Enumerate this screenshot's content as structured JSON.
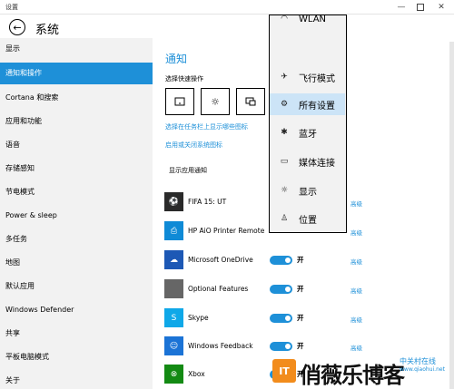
{
  "window": {
    "title": "设置"
  },
  "header": {
    "back_icon": "back-arrow-icon",
    "title": "系统"
  },
  "sidebar": {
    "items": [
      {
        "label": "显示",
        "active": false
      },
      {
        "label": "通知和操作",
        "active": true
      },
      {
        "label": "Cortana 和搜索",
        "active": false
      },
      {
        "label": "应用和功能",
        "active": false
      },
      {
        "label": "语音",
        "active": false
      },
      {
        "label": "存储感知",
        "active": false
      },
      {
        "label": "节电模式",
        "active": false
      },
      {
        "label": "Power & sleep",
        "active": false
      },
      {
        "label": "多任务",
        "active": false
      },
      {
        "label": "地图",
        "active": false
      },
      {
        "label": "默认应用",
        "active": false
      },
      {
        "label": "Windows Defender",
        "active": false
      },
      {
        "label": "共享",
        "active": false
      },
      {
        "label": "平板电脑模式",
        "active": false
      },
      {
        "label": "关于",
        "active": false
      }
    ]
  },
  "main": {
    "section_title": "通知",
    "quick_actions_label": "选择快速操作",
    "quick_action_icons": [
      "tablet-mode-icon",
      "brightness-icon",
      "project-icon"
    ],
    "taskbar_icons_link": "选择在任务栏上显示哪些图标",
    "system_icons_link": "启用或关闭系统图标",
    "show_app_notifications": "显示应用通知",
    "apps": [
      {
        "name": "FIFA 15: UT",
        "icon": "fifa-icon",
        "color": "#2a2a2a",
        "toggle": "",
        "advanced": "高级"
      },
      {
        "name": "HP AiO Printer Remote",
        "icon": "hp-printer-icon",
        "color": "#0f8ad6",
        "toggle": "",
        "advanced": "高级"
      },
      {
        "name": "Microsoft OneDrive",
        "icon": "onedrive-icon",
        "color": "#1d58b5",
        "toggle": "开",
        "advanced": "高级"
      },
      {
        "name": "Optional Features",
        "icon": "optional-features-icon",
        "color": "#666666",
        "toggle": "开",
        "advanced": "高级"
      },
      {
        "name": "Skype",
        "icon": "skype-icon",
        "color": "#0fa8e8",
        "toggle": "开",
        "advanced": "高级"
      },
      {
        "name": "Windows Feedback",
        "icon": "feedback-icon",
        "color": "#1b73d6",
        "toggle": "开",
        "advanced": "高级"
      },
      {
        "name": "Xbox",
        "icon": "xbox-icon",
        "color": "#138a13",
        "toggle": "开",
        "advanced": ""
      }
    ]
  },
  "dropdown": {
    "items": [
      {
        "label": "WLAN",
        "icon": "wifi-icon",
        "glyph": "◠",
        "active": false
      },
      {
        "label": "飞行模式",
        "icon": "airplane-icon",
        "glyph": "✈",
        "active": false
      },
      {
        "label": "所有设置",
        "icon": "gear-icon",
        "glyph": "⚙",
        "active": true
      },
      {
        "label": "蓝牙",
        "icon": "bluetooth-icon",
        "glyph": "✱",
        "active": false
      },
      {
        "label": "媒体连接",
        "icon": "media-connect-icon",
        "glyph": "▭",
        "active": false
      },
      {
        "label": "显示",
        "icon": "brightness-icon",
        "glyph": "☼",
        "active": false
      },
      {
        "label": "位置",
        "icon": "location-icon",
        "glyph": "♙",
        "active": false
      }
    ]
  },
  "watermark": {
    "logo_text": "IT",
    "main_text": "俏薇乐博客",
    "sub_text": "中关村在线",
    "url_text": "www.qiaohui.net"
  },
  "colors": {
    "accent": "#1e90d8",
    "sidebar_bg": "#f2f2f2",
    "dropdown_hover": "#cce4f7"
  }
}
